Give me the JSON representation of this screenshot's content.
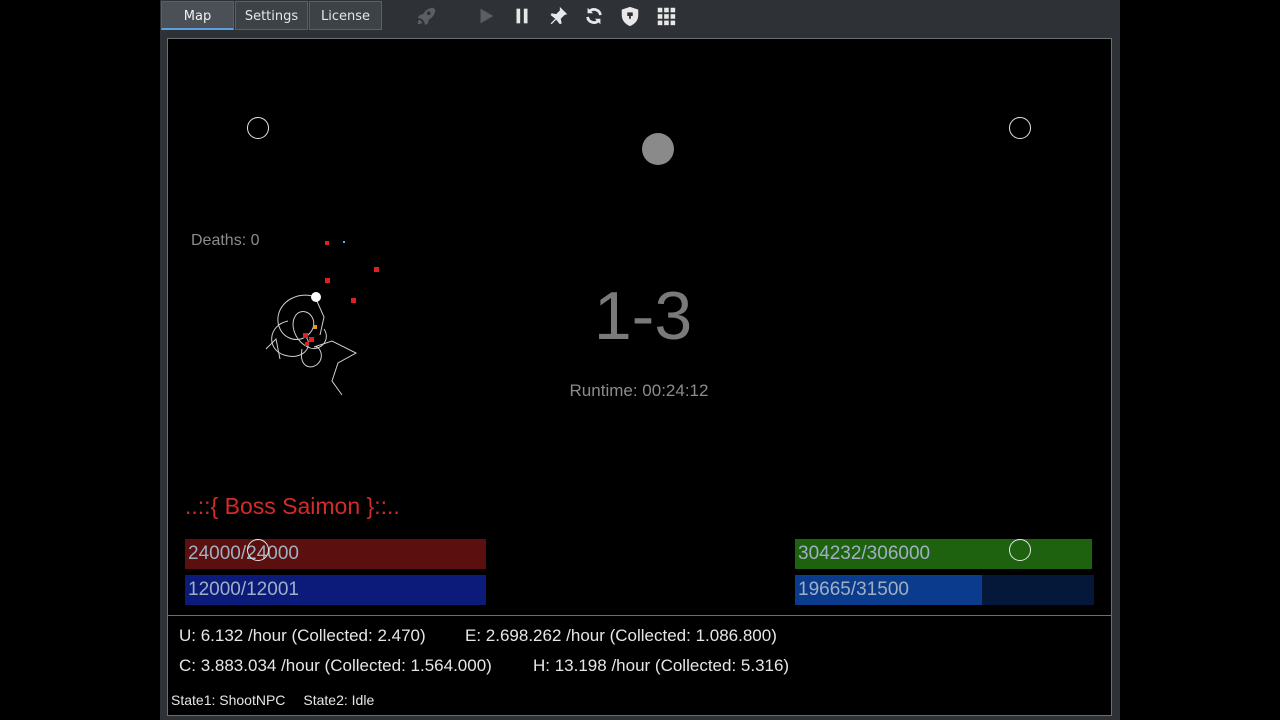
{
  "tabs": [
    {
      "label": "Map",
      "active": true
    },
    {
      "label": "Settings",
      "active": false
    },
    {
      "label": "License",
      "active": false
    }
  ],
  "toolbar": {
    "icons": [
      "rocket-icon",
      "play-icon",
      "pause-icon",
      "pin-icon",
      "refresh-icon",
      "shield-icon",
      "grid-icon"
    ]
  },
  "map": {
    "deaths": "Deaths: 0",
    "stage": "1-3",
    "runtime": "Runtime: 00:24:12",
    "boss_name": "..::{ Boss Saimon }::..",
    "bars": {
      "enemy_hp": {
        "text": "24000/24000",
        "fraction": 1.0,
        "color": "#5c0f0f"
      },
      "enemy_shield": {
        "text": "12000/12001",
        "fraction": 1.0,
        "color": "#0c1a7a"
      },
      "player_hp": {
        "text": "304232/306000",
        "fraction": 0.994,
        "color": "#1e6210"
      },
      "player_shield": {
        "text": "19665/31500",
        "fraction": 0.624,
        "color": "#0b3b8c",
        "track": "#06183a"
      }
    }
  },
  "stats": {
    "u": "U: 6.132 /hour (Collected: 2.470)",
    "e": "E: 2.698.262 /hour (Collected: 1.086.800)",
    "c": "C: 3.883.034 /hour (Collected: 1.564.000)",
    "h": "H: 13.198 /hour (Collected: 5.316)",
    "state1": "State1: ShootNPC",
    "state2": "State2: Idle"
  }
}
